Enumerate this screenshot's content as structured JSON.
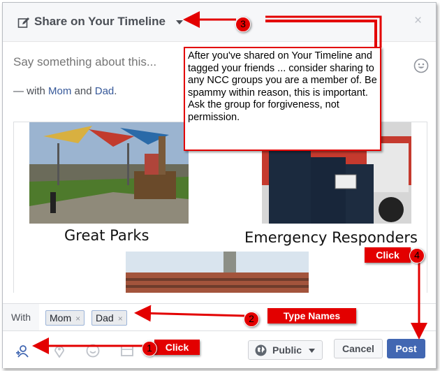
{
  "header": {
    "title": "Share on Your Timeline",
    "close_glyph": "×"
  },
  "composer": {
    "placeholder": "Say something about this...",
    "with_prefix": "— with ",
    "tagged": [
      "Mom",
      "Dad"
    ],
    "with_joiner": " and ",
    "with_suffix": "."
  },
  "attachment": {
    "captions": [
      "Great Parks",
      "Emergency Responders"
    ]
  },
  "with_bar": {
    "label": "With",
    "tokens": [
      {
        "name": "Mom",
        "remove": "×"
      },
      {
        "name": "Dad",
        "remove": "×"
      }
    ]
  },
  "footer": {
    "audience": "Public",
    "cancel": "Cancel",
    "post": "Post",
    "icons": [
      "tag-people-icon",
      "location-icon",
      "feeling-icon",
      "sticker-icon"
    ]
  },
  "annotations": {
    "note": "After you've shared on Your Timeline and tagged your friends ... consider sharing to any NCC groups you are a member of. Be spammy within reason, this is important. Ask the group for forgiveness, not permission.",
    "steps": [
      {
        "number": "1",
        "label": "Click"
      },
      {
        "number": "2",
        "label": "Type Names"
      },
      {
        "number": "3",
        "label": ""
      },
      {
        "number": "4",
        "label": "Click"
      }
    ]
  },
  "colors": {
    "accent": "#4267b2",
    "link": "#365899",
    "annotation_red": "#e30000"
  }
}
